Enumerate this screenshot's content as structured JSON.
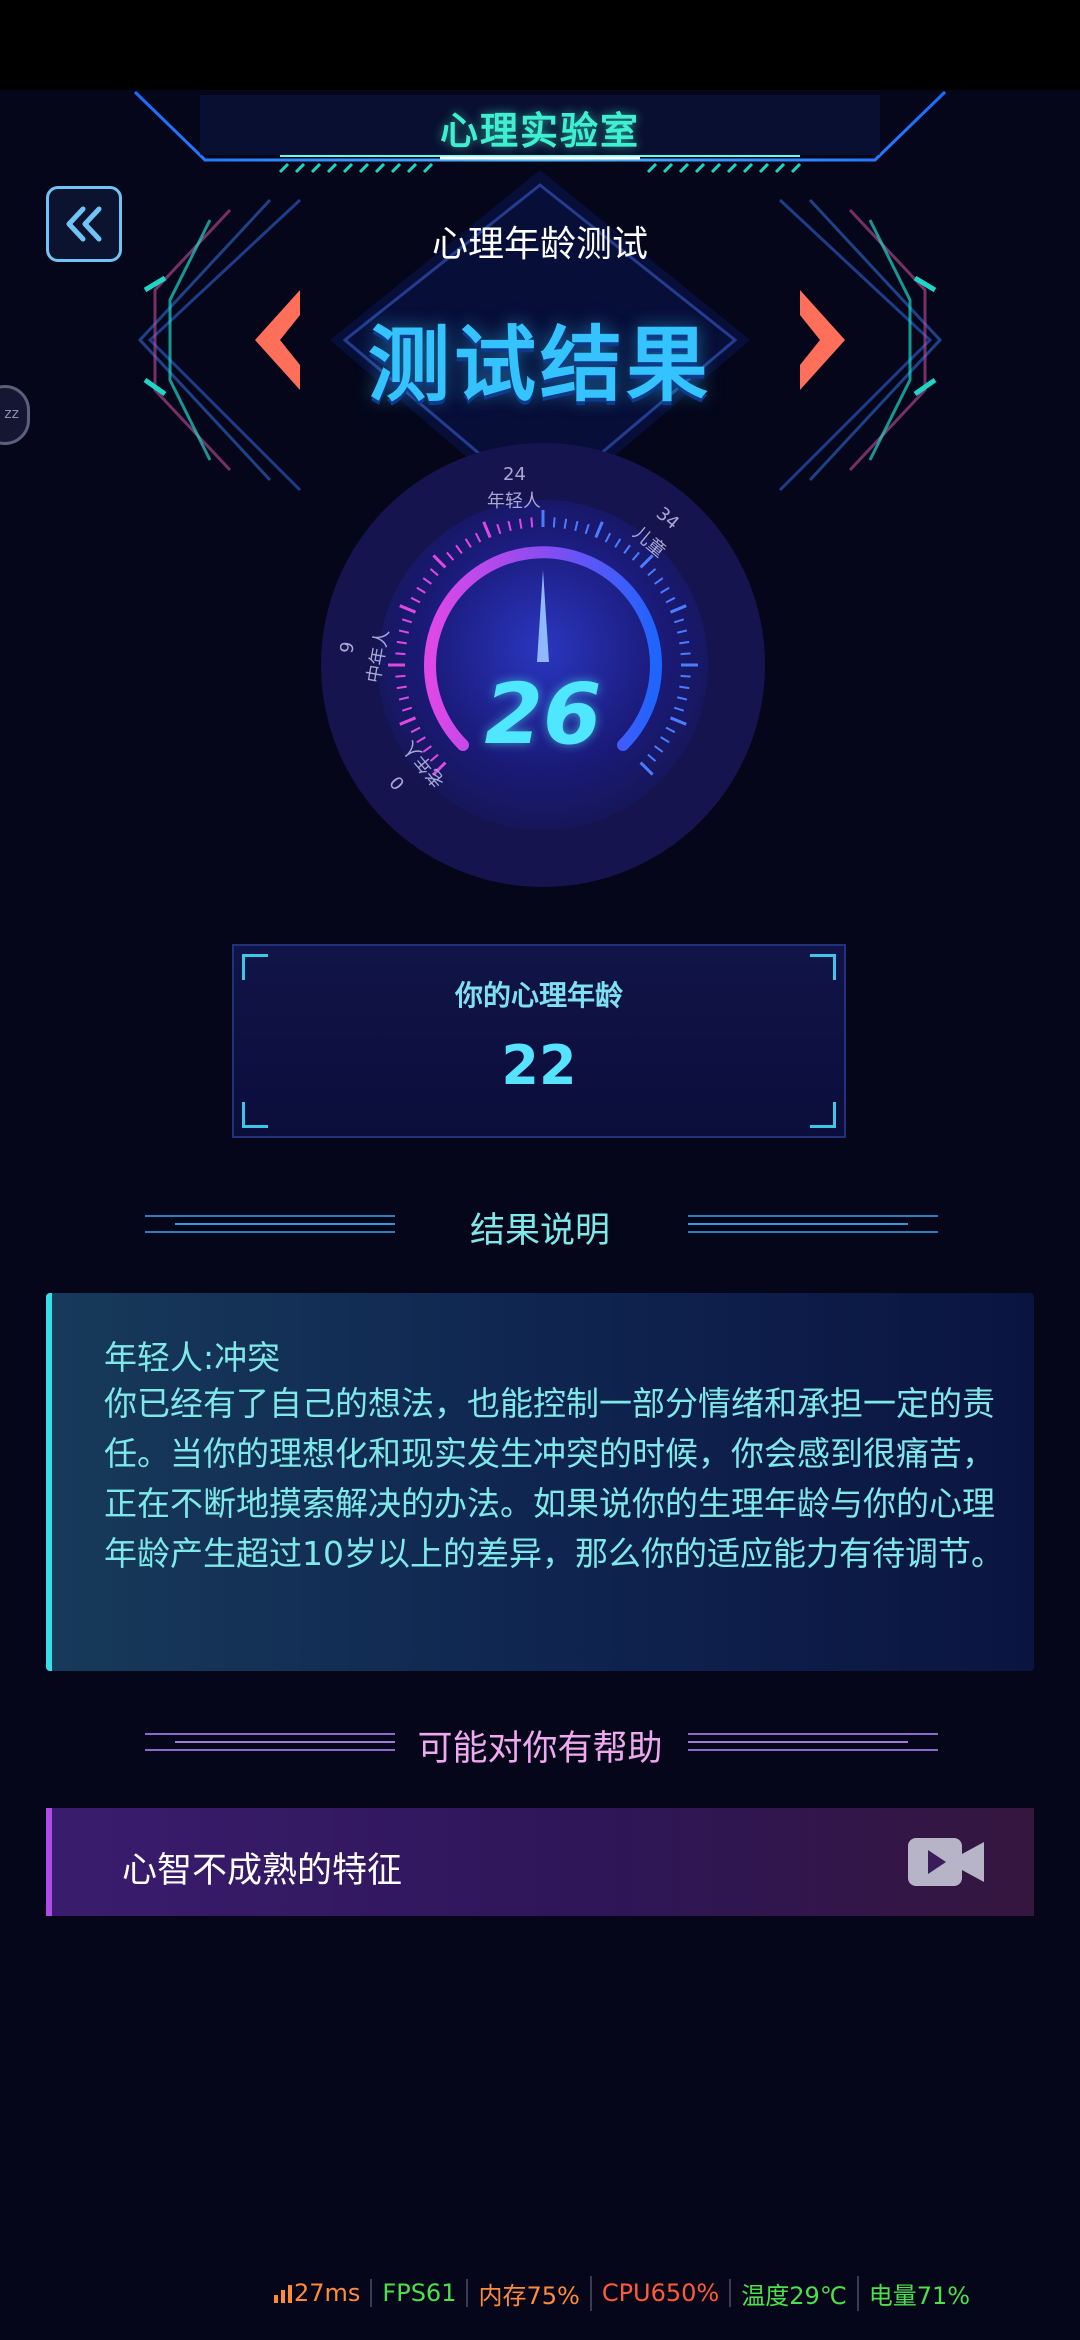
{
  "header": {
    "app_title": "心理实验室",
    "subtitle": "心理年龄测试",
    "main_title": "测试结果"
  },
  "side_pill": {
    "text": "zz"
  },
  "gauge": {
    "value": "26",
    "labels": {
      "top": "年轻人",
      "top_num": "24",
      "right": "儿童",
      "right_num": "34",
      "left": "中年人",
      "left_num": "9",
      "bottom_left": "老年人",
      "bottom_num": "0"
    }
  },
  "result": {
    "label": "你的心理年龄",
    "value": "22"
  },
  "explanation": {
    "heading": "结果说明",
    "title": "年轻人:冲突",
    "body": "你已经有了自己的想法，也能控制一部分情绪和承担一定的责任。当你的理想化和现实发生冲突的时候，你会感到很痛苦，正在不断地摸索解决的办法。如果说你的生理年龄与你的心理年龄产生超过10岁以上的差异，那么你的适应能力有待调节。"
  },
  "help": {
    "heading": "可能对你有帮助",
    "item_label": "心智不成熟的特征",
    "item_icon": "video-camera-icon"
  },
  "perf": {
    "latency": "27ms",
    "fps": "FPS61",
    "memory": "内存75%",
    "cpu": "CPU650%",
    "temp": "温度29℃",
    "battery": "电量71%"
  },
  "colors": {
    "background": "#05061a",
    "accent_cyan": "#3ff0d0",
    "title_blue": "#34c3ff",
    "pink_heading": "#f0a8f0",
    "purple_bar": "#b04ce6"
  }
}
